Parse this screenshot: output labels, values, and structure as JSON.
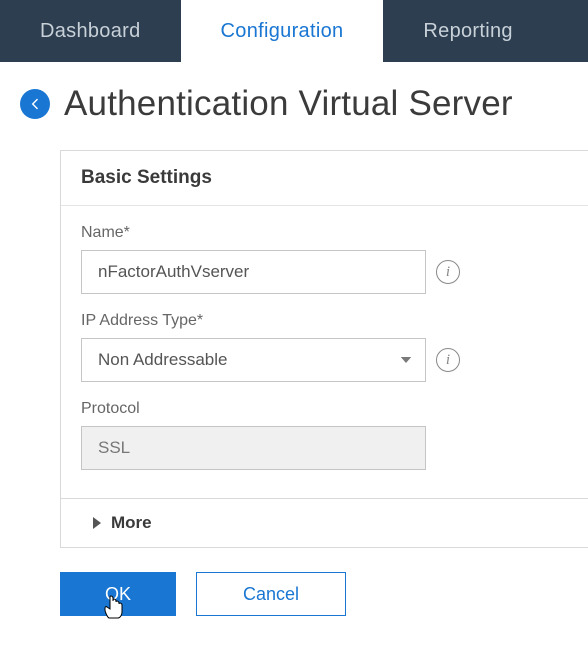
{
  "tabs": {
    "dashboard": "Dashboard",
    "configuration": "Configuration",
    "reporting": "Reporting"
  },
  "page": {
    "title": "Authentication Virtual Server"
  },
  "panel": {
    "heading": "Basic Settings",
    "name_label": "Name*",
    "name_value": "nFactorAuthVserver",
    "ip_label": "IP Address Type*",
    "ip_value": "Non Addressable",
    "protocol_label": "Protocol",
    "protocol_value": "SSL",
    "more_label": "More"
  },
  "buttons": {
    "ok": "OK",
    "cancel": "Cancel"
  },
  "icons": {
    "info": "i"
  }
}
